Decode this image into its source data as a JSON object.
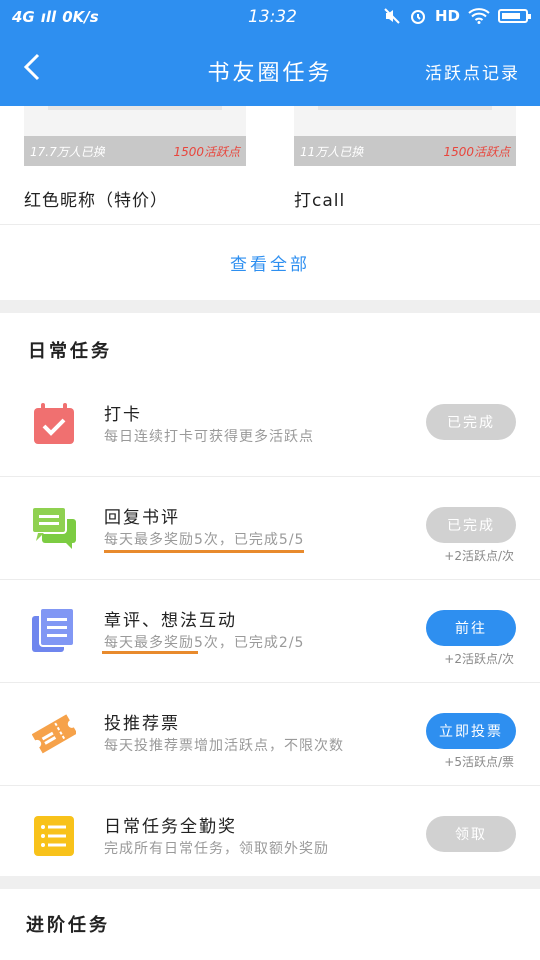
{
  "status_bar": {
    "network": "4G",
    "signal": "ıll",
    "speed": "0K/s",
    "time": "13:32",
    "hd": "HD"
  },
  "header": {
    "back_icon": "back-chevron-icon",
    "title": "书友圈任务",
    "right_link": "活跃点记录"
  },
  "rewards": {
    "items": [
      {
        "count": "17.7万人已换",
        "points": "1500活跃点",
        "name": "红色昵称（特价）"
      },
      {
        "count": "11万人已换",
        "points": "1500活跃点",
        "name": "打call"
      }
    ],
    "view_all": "查看全部"
  },
  "daily": {
    "title": "日常任务",
    "tasks": [
      {
        "icon": "calendar-check-icon",
        "name": "打卡",
        "desc": "每日连续打卡可获得更多活跃点",
        "button": "已完成",
        "button_state": "done",
        "note": ""
      },
      {
        "icon": "chat-bubbles-icon",
        "name": "回复书评",
        "desc": "每天最多奖励5次，已完成5/5",
        "button": "已完成",
        "button_state": "done",
        "note": "+2活跃点/次"
      },
      {
        "icon": "document-list-icon",
        "name": "章评、想法互动",
        "desc": "每天最多奖励5次，已完成2/5",
        "button": "前往",
        "button_state": "active",
        "note": "+2活跃点/次"
      },
      {
        "icon": "ticket-icon",
        "name": "投推荐票",
        "desc": "每天投推荐票增加活跃点，不限次数",
        "button": "立即投票",
        "button_state": "active",
        "note": "+5活跃点/票"
      },
      {
        "icon": "checklist-icon",
        "name": "日常任务全勤奖",
        "desc": "完成所有日常任务，领取额外奖励",
        "button": "领取",
        "button_state": "done",
        "note": ""
      }
    ]
  },
  "advanced": {
    "title": "进阶任务"
  },
  "colors": {
    "primary": "#2e8ff0",
    "points_red": "#e8453c",
    "underline_orange": "#e88a2d",
    "disabled": "#d1d1d1"
  }
}
